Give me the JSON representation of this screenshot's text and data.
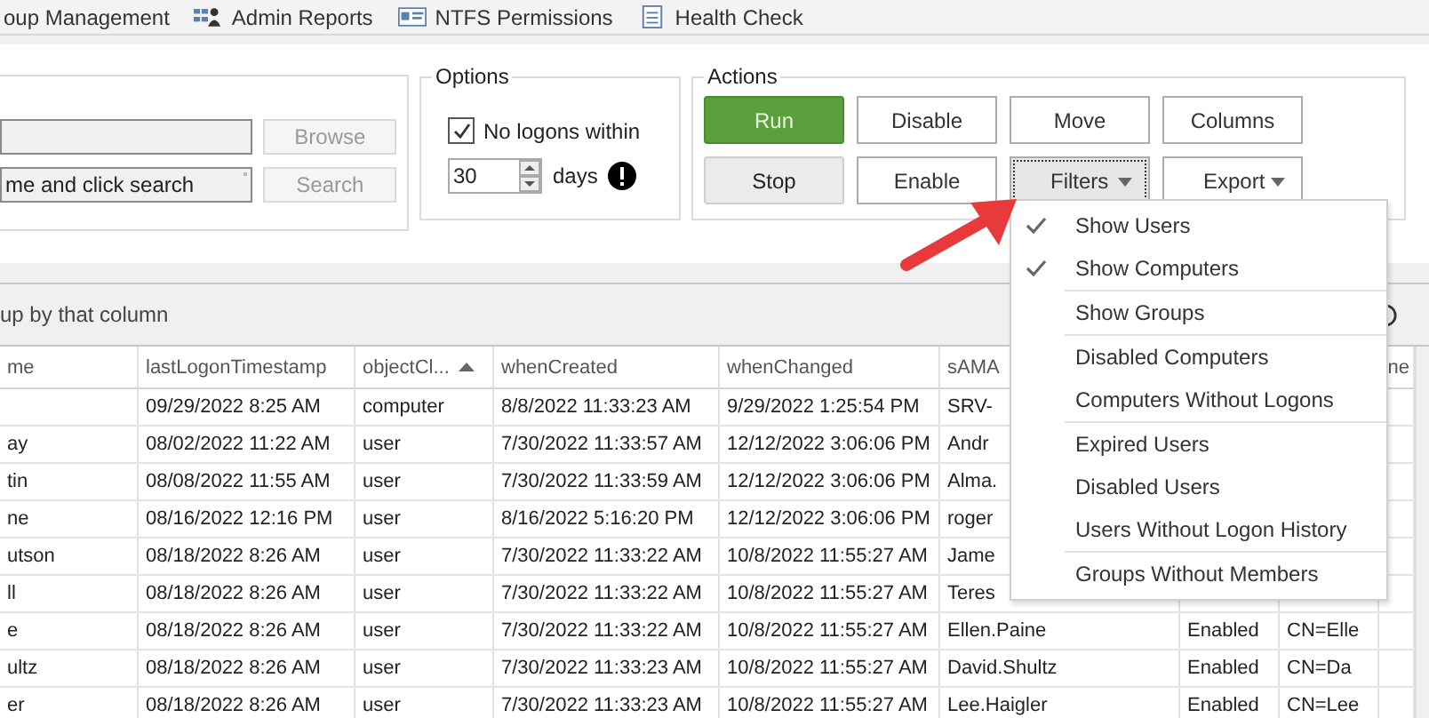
{
  "tabs": [
    {
      "label": "oup Management"
    },
    {
      "label": "Admin Reports"
    },
    {
      "label": "NTFS Permissions"
    },
    {
      "label": "Health Check"
    }
  ],
  "search": {
    "fields": [
      {
        "kind": "path"
      },
      {
        "kind": "name",
        "value": "me and click search"
      }
    ],
    "buttons": [
      {
        "label": "Browse",
        "disabled": true
      },
      {
        "label": "Search",
        "disabled": true
      }
    ]
  },
  "options": {
    "title": "Options",
    "no_logons": {
      "label": "No logons within",
      "checked": true
    },
    "days": {
      "value": "30",
      "unit": "days"
    }
  },
  "actions": {
    "title": "Actions",
    "buttons": [
      {
        "label": "Run",
        "kind": "primary",
        "focused": false
      },
      {
        "label": "Disable",
        "kind": "plain",
        "focused": false
      },
      {
        "label": "Move",
        "kind": "plain",
        "focused": false
      },
      {
        "label": "Columns",
        "kind": "plain",
        "focused": false
      },
      {
        "label": "Stop",
        "kind": "secondary",
        "focused": false
      },
      {
        "label": "Enable",
        "kind": "plain",
        "focused": false
      },
      {
        "label": "Filters",
        "kind": "dropdown",
        "focused": true
      },
      {
        "label": "Export",
        "kind": "dropdown",
        "focused": false
      }
    ]
  },
  "filters_menu": {
    "items": [
      {
        "kind": "item",
        "label": "Show Users",
        "checked": true
      },
      {
        "kind": "item",
        "label": "Show Computers",
        "checked": true
      },
      {
        "kind": "separator"
      },
      {
        "kind": "item",
        "label": "Show Groups",
        "checked": false
      },
      {
        "kind": "separator"
      },
      {
        "kind": "item",
        "label": "Disabled Computers",
        "checked": false
      },
      {
        "kind": "item",
        "label": "Computers Without Logons",
        "checked": false
      },
      {
        "kind": "separator"
      },
      {
        "kind": "item",
        "label": "Expired Users",
        "checked": false
      },
      {
        "kind": "item",
        "label": "Disabled Users",
        "checked": false
      },
      {
        "kind": "item",
        "label": "Users Without Logon History",
        "checked": false
      },
      {
        "kind": "separator"
      },
      {
        "kind": "item",
        "label": "Groups Without Members",
        "checked": false
      }
    ]
  },
  "grid": {
    "group_hint": "up by that column",
    "columns": [
      {
        "label": "me",
        "sorted": false
      },
      {
        "label": "lastLogonTimestamp",
        "sorted": false
      },
      {
        "label": "objectCl...",
        "sorted": true
      },
      {
        "label": "whenCreated",
        "sorted": false
      },
      {
        "label": "whenChanged",
        "sorted": false
      },
      {
        "label": "sAMA"
      },
      {},
      {},
      {
        "label": "ne",
        "sorted": false
      }
    ],
    "rows": [
      [
        null,
        "09/29/2022 8:25 AM",
        "computer",
        "8/8/2022 11:33:23 AM",
        "9/29/2022 1:25:54 PM",
        "SRV-"
      ],
      [
        "ay",
        "08/02/2022 11:22 AM",
        "user",
        "7/30/2022 11:33:57 AM",
        "12/12/2022 3:06:06 PM",
        "Andr"
      ],
      [
        "tin",
        "08/08/2022 11:55 AM",
        "user",
        "7/30/2022 11:33:59 AM",
        "12/12/2022 3:06:06 PM",
        "Alma."
      ],
      [
        "ne",
        "08/16/2022 12:16 PM",
        "user",
        "8/16/2022 5:16:20 PM",
        "12/12/2022 3:06:06 PM",
        "roger"
      ],
      [
        "utson",
        "08/18/2022 8:26 AM",
        "user",
        "7/30/2022 11:33:22 AM",
        "10/8/2022 11:55:27 AM",
        "Jame"
      ],
      [
        "ll",
        "08/18/2022 8:26 AM",
        "user",
        "7/30/2022 11:33:22 AM",
        "10/8/2022 11:55:27 AM",
        "Teres"
      ],
      [
        "e",
        "08/18/2022 8:26 AM",
        "user",
        "7/30/2022 11:33:22 AM",
        "10/8/2022 11:55:27 AM",
        "Ellen.Paine",
        "Enabled",
        "CN=Elle"
      ],
      [
        "ultz",
        "08/18/2022 8:26 AM",
        "user",
        "7/30/2022 11:33:23 AM",
        "10/8/2022 11:55:27 AM",
        "David.Shultz",
        "Enabled",
        "CN=Da"
      ],
      [
        "er",
        "08/18/2022 8:26 AM",
        "user",
        "7/30/2022 11:33:23 AM",
        "10/8/2022 11:55:27 AM",
        "Lee.Haigler",
        "Enabled",
        "CN=Lee"
      ]
    ]
  }
}
